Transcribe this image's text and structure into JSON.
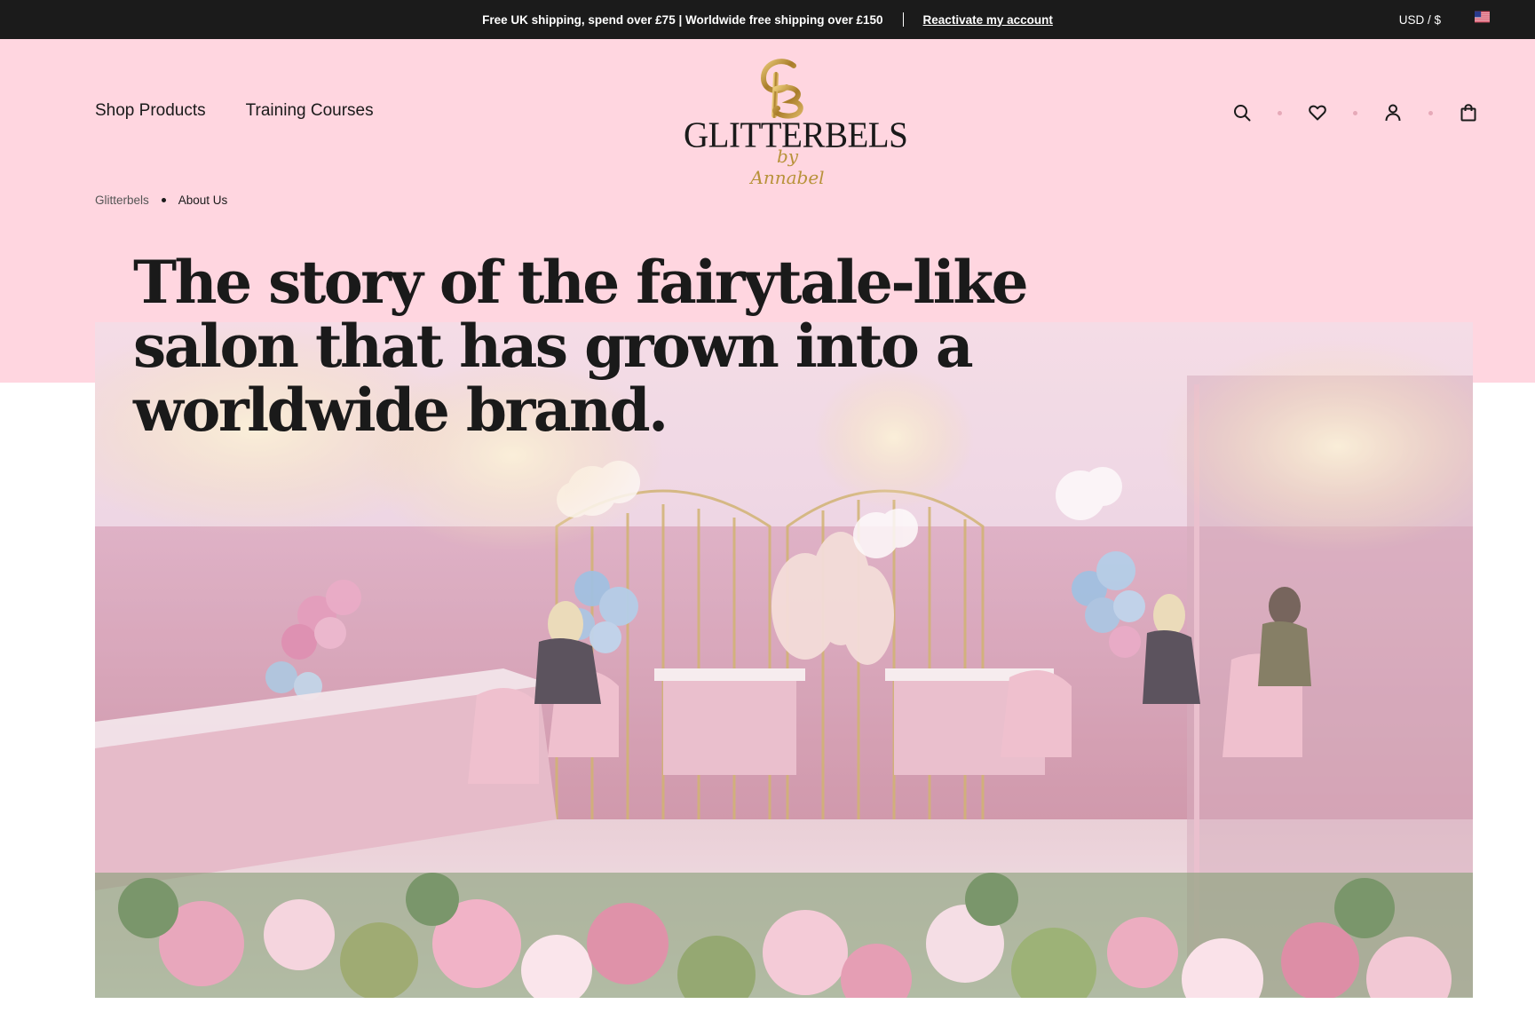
{
  "announcement": {
    "message": "Free UK shipping, spend over £75 | Worldwide free shipping over £150",
    "link": "Reactivate my account",
    "currency": "USD / $"
  },
  "nav": {
    "items": [
      {
        "label": "Shop Products"
      },
      {
        "label": "Training Courses"
      }
    ]
  },
  "logo": {
    "name": "GLITTERBELS",
    "tagline": "by Annabel"
  },
  "header_icons": [
    "search-icon",
    "heart-icon",
    "account-icon",
    "cart-icon"
  ],
  "breadcrumb": {
    "home": "Glitterbels",
    "current": "About Us"
  },
  "hero": {
    "title": "The story of the fairytale-like salon that has grown into a worldwide brand."
  },
  "colors": {
    "announcement_bg": "#1b1b1b",
    "header_pink": "#ffd6e0",
    "accent_gold": "#b8923a"
  }
}
